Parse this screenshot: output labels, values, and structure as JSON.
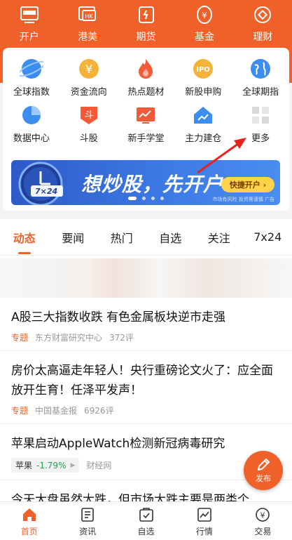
{
  "topnav": [
    {
      "label": "开户",
      "icon": "account-open-icon"
    },
    {
      "label": "港美",
      "icon": "hk-us-icon"
    },
    {
      "label": "期货",
      "icon": "futures-icon"
    },
    {
      "label": "基金",
      "icon": "fund-icon"
    },
    {
      "label": "理财",
      "icon": "wealth-icon"
    }
  ],
  "grid": [
    {
      "label": "全球指数",
      "icon": "globe-icon"
    },
    {
      "label": "资金流向",
      "icon": "money-flow-icon"
    },
    {
      "label": "热点题材",
      "icon": "flame-icon"
    },
    {
      "label": "新股申购",
      "icon": "ipo-icon"
    },
    {
      "label": "全球期指",
      "icon": "earth-icon"
    },
    {
      "label": "数据中心",
      "icon": "pie-chart-icon"
    },
    {
      "label": "斗股",
      "icon": "battle-stock-icon"
    },
    {
      "label": "新手学堂",
      "icon": "tutorial-icon"
    },
    {
      "label": "主力建仓",
      "icon": "house-chart-icon"
    },
    {
      "label": "更多",
      "icon": "more-grid-icon"
    }
  ],
  "banner": {
    "badge": "7×24",
    "title": "想炒股，先开户",
    "button": "快捷开户 ›",
    "note": "市场有风险 投资需谨慎  广告"
  },
  "tabs": [
    "动态",
    "要闻",
    "热门",
    "自选",
    "关注",
    "7x24"
  ],
  "news": [
    {
      "title": "A股三大指数收跌 有色金属板块逆市走强",
      "tag": "专题",
      "source": "东方财富研究中心",
      "comments": "372评"
    },
    {
      "title": "房价太高逼走年轻人！央行重磅论文火了：应全面放开生育！任泽平发声！",
      "tag": "专题",
      "source": "中国基金报",
      "comments": "6926评"
    },
    {
      "title": "苹果启动AppleWatch检测新冠病毒研究",
      "stock_name": "苹果",
      "stock_change": "-1.79%",
      "source": "财经网"
    },
    {
      "title": "今天大盘虽然大跌，但市场大跌主要是两类个"
    }
  ],
  "fab": {
    "label": "发布"
  },
  "bottomnav": [
    {
      "label": "首页",
      "icon": "home-icon",
      "active": true
    },
    {
      "label": "资讯",
      "icon": "news-icon"
    },
    {
      "label": "自选",
      "icon": "watchlist-icon"
    },
    {
      "label": "行情",
      "icon": "market-icon"
    },
    {
      "label": "交易",
      "icon": "trade-icon"
    }
  ],
  "colors": {
    "brand": "#f0612a",
    "down_green": "#1aa34a"
  }
}
